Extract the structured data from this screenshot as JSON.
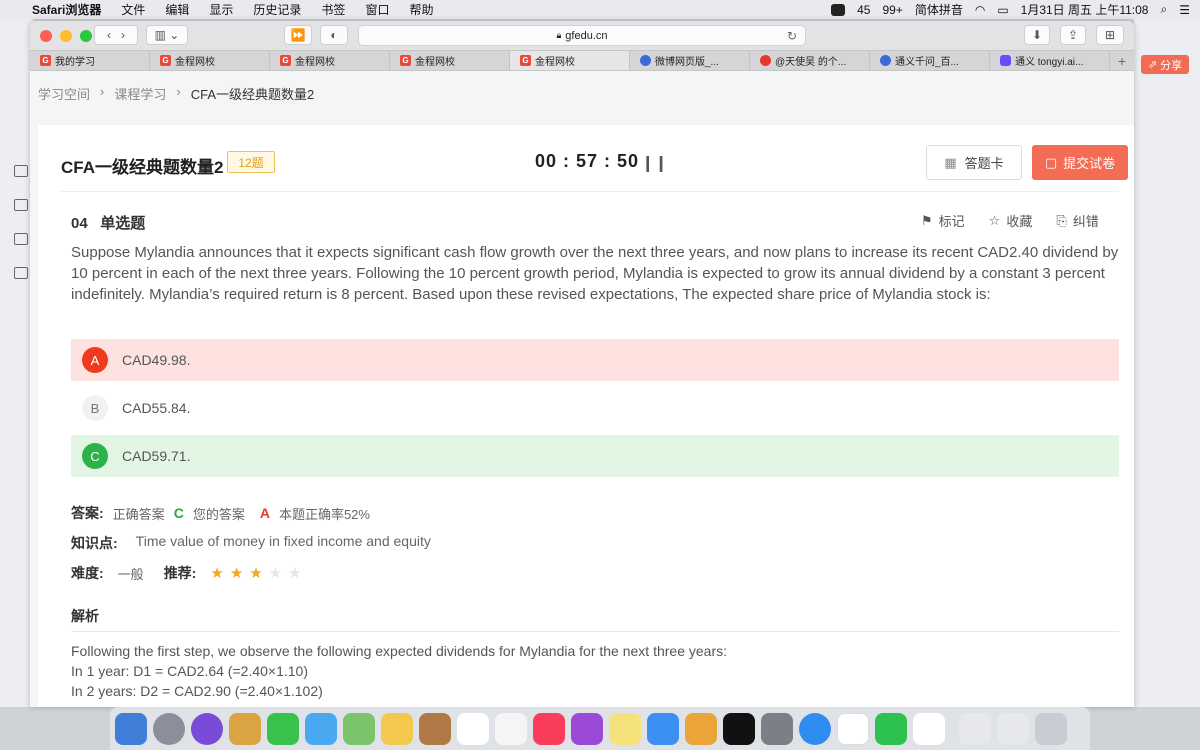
{
  "menubar": {
    "app": "Safari浏览器",
    "items": [
      "文件",
      "编辑",
      "显示",
      "历史记录",
      "书签",
      "窗口",
      "帮助"
    ],
    "status": {
      "notifications": "45",
      "wechat": "99+",
      "input": "简体拼音",
      "datetime": "1月31日 周五 上午11:08"
    }
  },
  "browser": {
    "url": "gfedu.cn",
    "tabs": [
      {
        "label": "我的学习",
        "icon": "gf"
      },
      {
        "label": "金程网校",
        "icon": "gf"
      },
      {
        "label": "金程网校",
        "icon": "gf"
      },
      {
        "label": "金程网校",
        "icon": "gf"
      },
      {
        "label": "金程网校",
        "icon": "gf"
      },
      {
        "label": "微博网页版_...",
        "icon": "paw"
      },
      {
        "label": "@天使吴 的个...",
        "icon": "weibo"
      },
      {
        "label": "通义千问_百...",
        "icon": "paw"
      },
      {
        "label": "通义 tongyi.ai...",
        "icon": "tongyi"
      }
    ],
    "share_label": "分享"
  },
  "page": {
    "breadcrumb": [
      "学习空间",
      "课程学习",
      "CFA一级经典题数量2"
    ],
    "title": "CFA一级经典题数量2",
    "count_badge": "12题",
    "timer": "00 : 57 : 50",
    "pause_glyph": "❙❙",
    "answer_card_label": "答题卡",
    "submit_label": "提交试卷",
    "question": {
      "number": "04",
      "type": "单选题",
      "tools": [
        "标记",
        "收藏",
        "纠错"
      ],
      "text": "Suppose Mylandia announces that it expects significant cash flow growth over the next three years, and now plans to increase its recent CAD2.40 dividend by 10 percent in each of the next three years. Following the 10 percent growth period, Mylandia is expected to grow its annual dividend by a constant 3 percent indefinitely. Mylandia’s required return is 8 percent. Based upon these revised expectations, The expected share price of Mylandia stock is:",
      "options": [
        {
          "letter": "A",
          "text": "CAD49.98.",
          "state": "wrong"
        },
        {
          "letter": "B",
          "text": "CAD55.84.",
          "state": "plain"
        },
        {
          "letter": "C",
          "text": "CAD59.71.",
          "state": "right"
        }
      ]
    },
    "answer": {
      "label": "答案:",
      "correct_label": "正确答案",
      "correct": "C",
      "yours_label": "您的答案",
      "yours": "A",
      "rate": "本题正确率52%"
    },
    "knowledge": {
      "label": "知识点:",
      "value": "Time value of money in fixed income and equity"
    },
    "difficulty": {
      "label": "难度:",
      "value": "一般",
      "recommend_label": "推荐:",
      "stars": 3,
      "max_stars": 5
    },
    "analysis": {
      "title": "解析",
      "lines": [
        "Following the first step, we observe the following expected dividends for Mylandia for the next three years:",
        "In 1 year: D1 = CAD2.64 (=2.40×1.10)",
        "In 2 years: D2 = CAD2.90 (=2.40×1.102)"
      ]
    }
  },
  "colors": {
    "accent": "#f56c55",
    "wrong": "#f03a1e",
    "right": "#2bb34a",
    "star": "#f5a623"
  }
}
